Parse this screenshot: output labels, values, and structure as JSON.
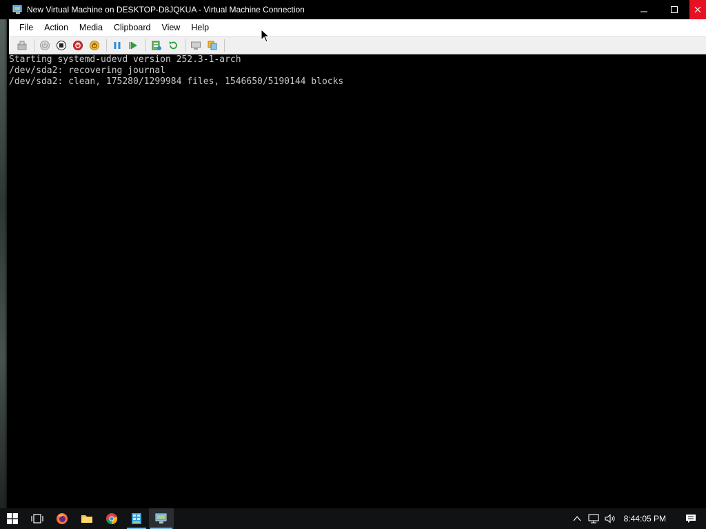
{
  "window": {
    "title": "New Virtual Machine on DESKTOP-D8JQKUA - Virtual Machine Connection",
    "controls": {
      "minimize": "—",
      "maximize": "□",
      "close": "✕"
    }
  },
  "menu": {
    "items": [
      {
        "label": "File"
      },
      {
        "label": "Action"
      },
      {
        "label": "Media"
      },
      {
        "label": "Clipboard"
      },
      {
        "label": "View"
      },
      {
        "label": "Help"
      }
    ]
  },
  "toolbar": {
    "buttons": [
      "ctrl-alt-del-icon",
      "start-icon",
      "turn-off-icon",
      "shut-down-icon",
      "save-icon",
      "pause-icon",
      "resume-icon",
      "checkpoint-icon",
      "revert-icon",
      "enhanced-session-icon",
      "share-icon"
    ]
  },
  "console": {
    "lines": [
      "Starting systemd-udevd version 252.3-1-arch",
      "/dev/sda2: recovering journal",
      "/dev/sda2: clean, 175280/1299984 files, 1546650/5190144 blocks"
    ],
    "text_color": "#c7c7c7",
    "background": "#000000"
  },
  "taskbar": {
    "apps": [
      {
        "name": "start-icon"
      },
      {
        "name": "task-view-icon"
      },
      {
        "name": "firefox-icon"
      },
      {
        "name": "file-explorer-icon"
      },
      {
        "name": "chrome-icon"
      },
      {
        "name": "hyper-v-manager-icon"
      },
      {
        "name": "vm-connection-icon"
      }
    ],
    "clock": "8:44:05 PM"
  },
  "colors": {
    "close_button": "#e81123",
    "taskbar_accent": "#76b9ed"
  }
}
